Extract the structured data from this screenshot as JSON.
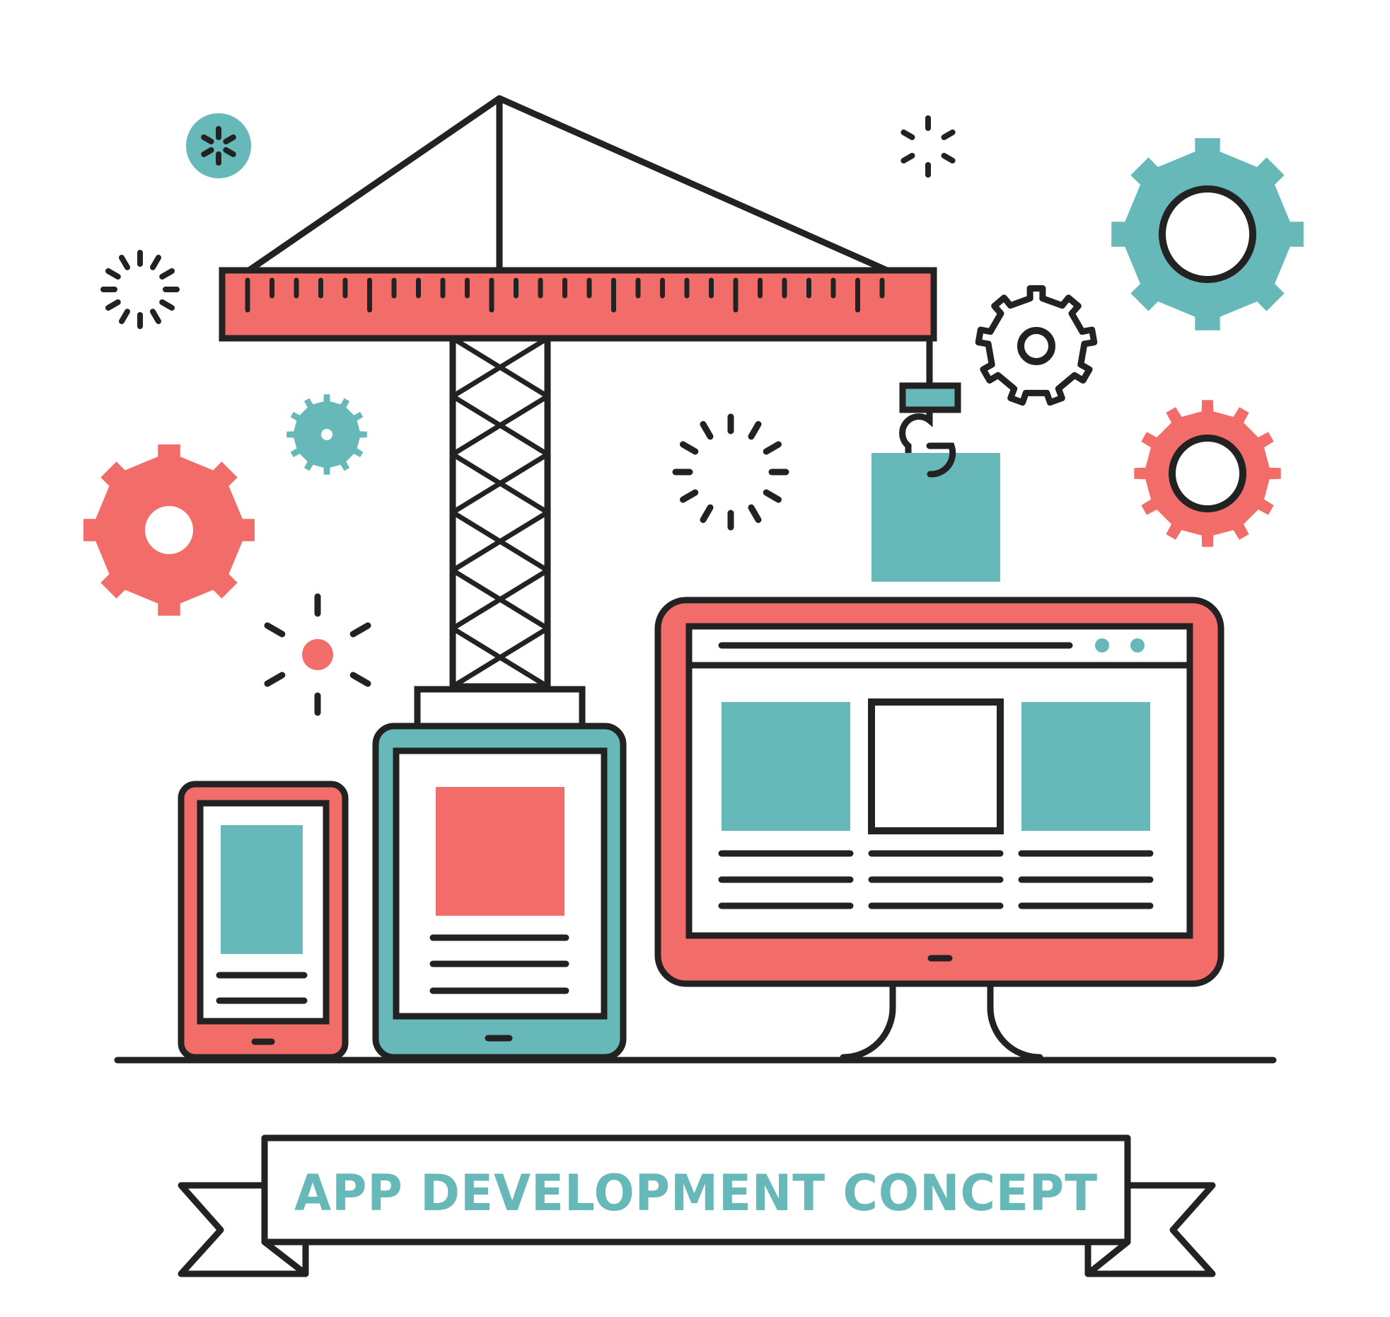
{
  "banner": {
    "title": "APP DEVELOPMENT CONCEPT"
  },
  "colors": {
    "outline": "#222222",
    "coral": "#F26D69",
    "teal": "#67B9B9",
    "background": "#FFFFFF"
  },
  "icons": [
    "crane-icon",
    "hook-icon",
    "cargo-block-icon",
    "gear-icon",
    "sparkle-icon",
    "smartphone-icon",
    "tablet-icon",
    "desktop-monitor-icon",
    "ribbon-banner"
  ]
}
